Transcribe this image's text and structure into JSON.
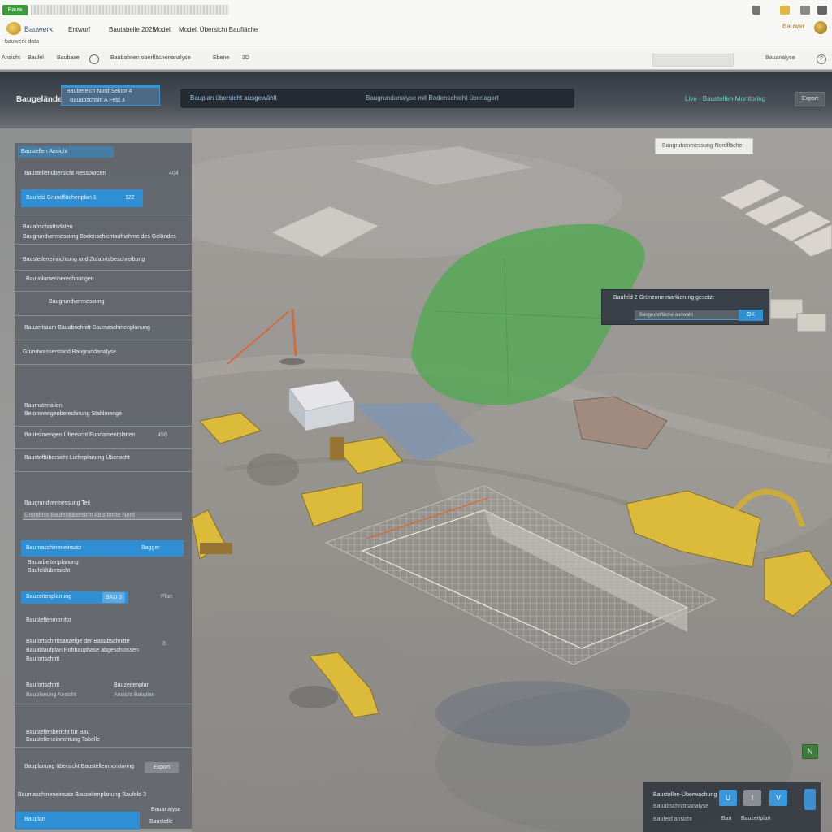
{
  "app": {
    "badge": "Bauw",
    "name": "Bauwerk",
    "subname": "bauwerk data",
    "user_label": "Bauwer",
    "user_avatar_icon": "user-avatar-icon"
  },
  "menu": {
    "items": [
      "Entwurf",
      "Bautabelle 2025",
      "Modell",
      "Modell Übersicht Baufläche"
    ]
  },
  "toolbar": {
    "items": [
      "Ansicht",
      "Baufel",
      "Baubase",
      "Baubahnen oberflächenanalyse",
      "Ebene",
      "3D"
    ],
    "right_label": "Bauanalyse",
    "help_icon": "help-icon"
  },
  "project": {
    "title": "Baugelände",
    "dropdown_line1": "Baubereich Nord Sektor 4",
    "dropdown_line2": "Bauabschnitt A  Feld 3",
    "search_text": "Bauplan übersicht ausgewählt",
    "search_secondary": "Baugrundanalyse mit Bodenschicht überlagert",
    "status_link": "Live · Baustellen-Monitoring",
    "action_label": "Export"
  },
  "left_panel": {
    "header": "Baustellen Ansicht",
    "row1": "Baustellenübersicht Ressourcen",
    "row1_value": "404",
    "selected_item": "Baufeld  Grundflächenplan 1",
    "selected_value": "122",
    "rows": [
      "Bauabschnittsdaten",
      "Baugrundvermessung  Bodenschichtaufnahme des Geländes",
      "Baustelleneinrichtung und Zufahrtsbeschreibung",
      "Bauvolumenberechnungen",
      "Baugrundvermessung",
      "Bauzeitraum  Bauabschnitt  Baumaschinenplanung",
      "Grundwasserstand  Baugrundanalyse"
    ],
    "group2_title": "Baumaterialien",
    "group2_sub": "Betonmengenberechnung Stahlmenge",
    "group2_row": "Bauteilmengen Übersicht Fundamentplatten",
    "group2_value": "456",
    "group2_row2": "Baustoffübersicht Lieferplanung Übersicht",
    "field1_label": "Baugrundvermessung Teil",
    "field1_value": "Grundriss Baufeldübersicht Abschnitte Nord",
    "blue2_label": "Baumaschineneinsatz",
    "blue2_value": "Bagger",
    "sub2a": "Bauarbeitenplanung",
    "sub2b": "Baufeldübersicht",
    "blue3_label": "Bauzeitenplanung",
    "blue3_btn": "BAU 3",
    "blue3_right": "Plan",
    "sub3": "Baustellenmonitor",
    "desc1": "Baufortschrittsanzeige der Bauabschnitte",
    "desc2": "Bauablaufplan Rohbauphase abgeschlossen",
    "desc3": "Baufortschritt",
    "meta1": "Baufortschritt",
    "meta2": "Bauzeitenplan",
    "meta3": "Bauplanung Ansicht",
    "meta4": "Ansicht Bauplan",
    "meta_val": "3",
    "group3_title": "Baustellenbericht für Bau",
    "group3_sub": "Baustelleneinrichtung Tabelle",
    "footer_text": "Bauplanung übersicht Baustellenmonitoring",
    "footer_btn": "Export",
    "last_row": "Baumaschineneinsatz Bauzeitenplanung  Baufeld 3",
    "last_right": "Bauanalyse",
    "bottom_blue": "Bauplan",
    "bottom_right": "Baustelle"
  },
  "overlays": {
    "info_card": "Baugrubenmessung Nordfläche",
    "zone_popup_title": "Baufeld 2  Grünzone markierung gesetzt",
    "zone_popup_field": "Baugrundfläche auswahl",
    "zone_popup_button": "OK",
    "map_badge": "N",
    "bottom_card_title": "Baustellen-Überwachung",
    "bottom_card_line2": "Bauabschnittsanalyse",
    "bottom_card_line3": "Baufeld ansicht",
    "bottom_card_label": "Bauzeitplan",
    "bottom_card_label2": "Bau",
    "bc_btn1": "U",
    "bc_btn2": "I",
    "bc_btn3": "V"
  },
  "colors": {
    "accent_blue": "#2e8fd4",
    "zone_green": "#4aa04a",
    "machine_yellow": "#d9b52a",
    "panel": "#525860"
  }
}
